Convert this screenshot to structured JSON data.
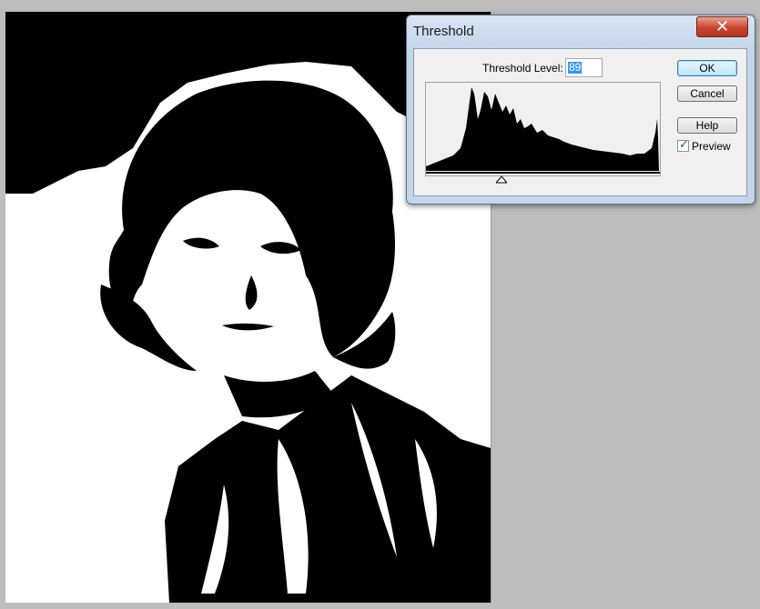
{
  "dialog": {
    "title": "Threshold",
    "close_glyph": "✕",
    "threshold_label": "Threshold Level:",
    "threshold_value": "89",
    "buttons": {
      "ok": "OK",
      "cancel": "Cancel",
      "help": "Help"
    },
    "preview_label": "Preview",
    "preview_checked": true,
    "check_glyph": "✓"
  },
  "icons": [
    "close-icon",
    "checkmark-icon",
    "slider-thumb-icon"
  ],
  "colors": {
    "canvas_bg": "#bdbdbd",
    "image_dark": "#000000",
    "image_light": "#ffffff",
    "close_red": "#c9442c"
  }
}
